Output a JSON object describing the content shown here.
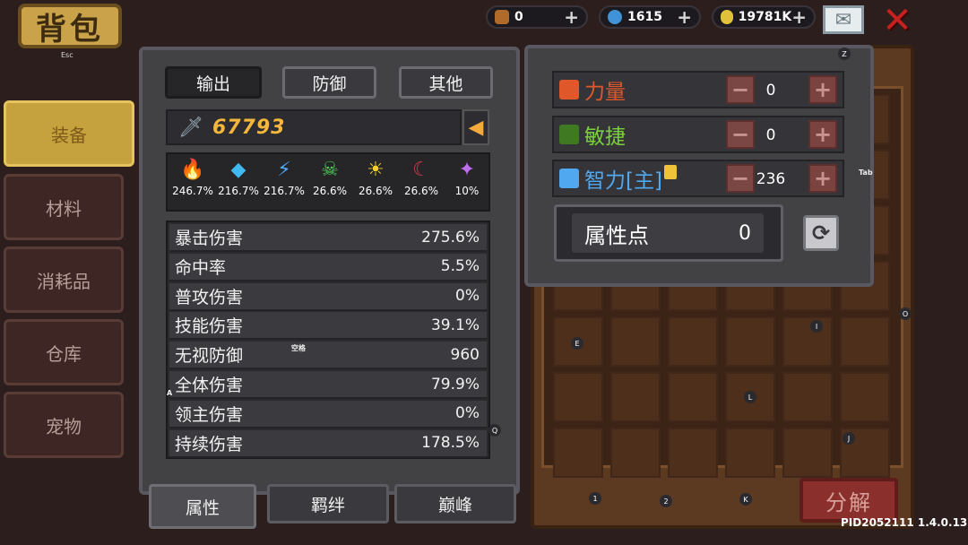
{
  "header": {
    "title": "背包",
    "esc_hint": "Esc",
    "currencies": [
      {
        "name": "food",
        "value": "0",
        "color": "#b06a2a"
      },
      {
        "name": "gem",
        "value": "1615",
        "color": "#3f93d6"
      },
      {
        "name": "gold",
        "value": "19781K",
        "color": "#e0c23a"
      }
    ]
  },
  "sidebar": {
    "tabs": [
      {
        "label": "装备",
        "active": true
      },
      {
        "label": "材料",
        "active": false
      },
      {
        "label": "消耗品",
        "active": false
      },
      {
        "label": "仓库",
        "active": false
      },
      {
        "label": "宠物",
        "active": false
      }
    ]
  },
  "stats": {
    "tabs": [
      "输出",
      "防御",
      "其他"
    ],
    "power": "67793",
    "elements": [
      {
        "icon": "fire-icon",
        "glyph": "🔥",
        "color": "#f08a2a",
        "value": "246.7%"
      },
      {
        "icon": "ice-icon",
        "glyph": "◆",
        "color": "#3fb9f0",
        "value": "216.7%"
      },
      {
        "icon": "lightning-icon",
        "glyph": "⚡",
        "color": "#4fa8ff",
        "value": "216.7%"
      },
      {
        "icon": "poison-icon",
        "glyph": "☠",
        "color": "#4fd15a",
        "value": "26.6%"
      },
      {
        "icon": "light-icon",
        "glyph": "☀",
        "color": "#f5d02a",
        "value": "26.6%"
      },
      {
        "icon": "dark-icon",
        "glyph": "☾",
        "color": "#d43b4a",
        "value": "26.6%"
      },
      {
        "icon": "arcane-icon",
        "glyph": "✦",
        "color": "#c06ef0",
        "value": "10%"
      }
    ],
    "rows": [
      {
        "label": "暴击伤害",
        "value": "275.6%"
      },
      {
        "label": "命中率",
        "value": "5.5%"
      },
      {
        "label": "普攻伤害",
        "value": "0%"
      },
      {
        "label": "技能伤害",
        "value": "39.1%"
      },
      {
        "label": "无视防御",
        "value": "960"
      },
      {
        "label": "全体伤害",
        "value": "79.9%"
      },
      {
        "label": "领主伤害",
        "value": "0%"
      },
      {
        "label": "持续伤害",
        "value": "178.5%"
      }
    ],
    "bottom_tabs": [
      "属性",
      "羁绊",
      "巅峰"
    ]
  },
  "alloc": {
    "rows": [
      {
        "label": "力量",
        "value": "0",
        "color": "#e0572a",
        "icon": "fist-icon"
      },
      {
        "label": "敏捷",
        "value": "0",
        "color": "#7ad13a",
        "icon": "feather-icon"
      },
      {
        "label": "智力[主]",
        "value": "236",
        "color": "#4fa8f0",
        "icon": "book-icon"
      }
    ],
    "points_label": "属性点",
    "points_value": "0",
    "minus_glyph": "−",
    "plus_glyph": "+"
  },
  "inventory": {
    "decompose_label": "分解",
    "version": "PID2052111 1.4.0.13"
  },
  "hints": {
    "space": "空格",
    "z": "Z",
    "tab": "Tab",
    "e": "E",
    "i": "I",
    "o": "O",
    "l": "L",
    "j": "J",
    "q": "Q",
    "a": "A",
    "one": "1",
    "two": "2",
    "k": "K"
  }
}
